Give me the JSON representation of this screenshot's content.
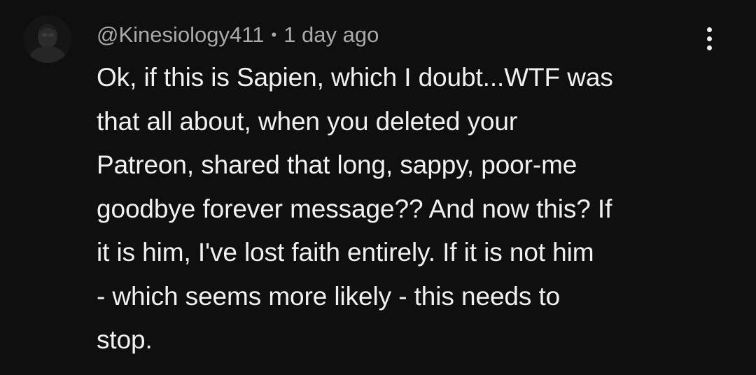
{
  "comment": {
    "username": "@Kinesiology411",
    "separator": "•",
    "timestamp": "1 day ago",
    "lines": [
      "Ok, if this is Sapien, which I doubt...WTF was",
      "that all about, when you deleted your",
      "Patreon, shared that long, sappy, poor-me",
      "goodbye forever message?? And now this? If",
      "it is him, I've lost faith entirely. If it is not him",
      "- which seems more likely - this needs to",
      "stop."
    ],
    "avatar_icon": "user-avatar",
    "menu_icon": "more-vertical-icon"
  },
  "colors": {
    "background": "#0f0f0f",
    "text_primary": "#f1f1f1",
    "text_secondary": "#aaaaaa"
  }
}
